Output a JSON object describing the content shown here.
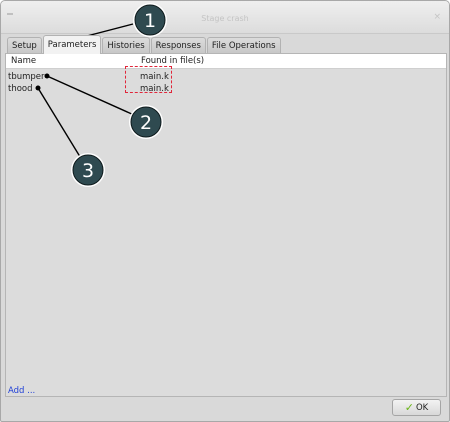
{
  "window": {
    "title": "Stage crash",
    "close_glyph": "×"
  },
  "tabs": [
    {
      "label": "Setup"
    },
    {
      "label": "Parameters"
    },
    {
      "label": "Histories"
    },
    {
      "label": "Responses"
    },
    {
      "label": "File Operations"
    }
  ],
  "table": {
    "columns": [
      "Name",
      "Found in file(s)"
    ],
    "rows": [
      {
        "name": "tbumper",
        "file": "main.k"
      },
      {
        "name": "thood",
        "file": "main.k"
      }
    ]
  },
  "add_link": "Add ...",
  "ok_button": {
    "label": "OK",
    "icon": "checkmark-icon",
    "icon_glyph": "✓"
  },
  "annotations": {
    "markers": [
      "1",
      "2",
      "3"
    ],
    "marker_color": "#2f4a50",
    "line_color": "#000000",
    "highlight_color": "#e0263a"
  }
}
